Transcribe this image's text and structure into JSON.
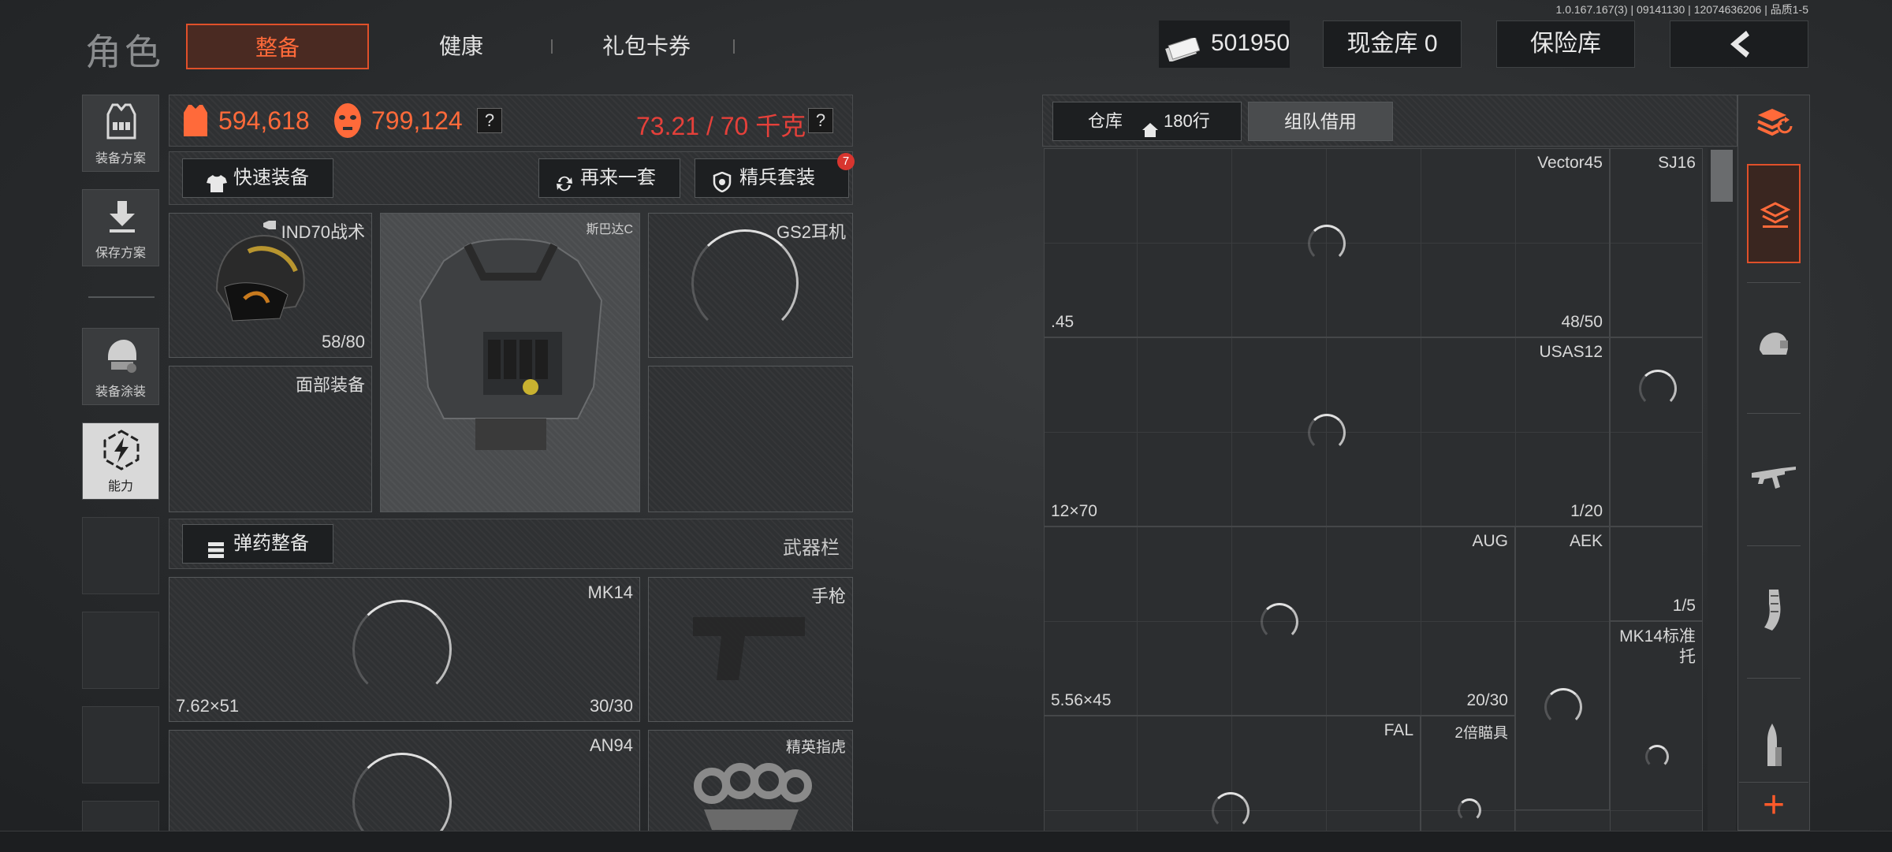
{
  "build_info": "1.0.167.167(3) | 09141130 | 12074636206 | 品质1-5",
  "header": {
    "title": "角色",
    "tabs": [
      {
        "label": "整备",
        "active": true
      },
      {
        "label": "健康",
        "active": false
      },
      {
        "label": "礼包卡券",
        "active": false
      }
    ],
    "currency": "501950",
    "cash_vault": "现金库 0",
    "safe_vault": "保险库",
    "back_icon": "chevron-left-icon"
  },
  "sidebar": {
    "items": [
      {
        "label": "装备方案",
        "icon": "vest-icon"
      },
      {
        "label": "保存方案",
        "icon": "download-icon"
      },
      {
        "label": "装备涂装",
        "icon": "helmet-paint-icon"
      },
      {
        "label": "能力",
        "icon": "ability-icon",
        "active": true
      }
    ]
  },
  "stats": {
    "armor_value": "594,618",
    "mask_value": "799,124",
    "weight": "73.21 / 70 千克",
    "help": "?"
  },
  "loadout_bar": {
    "quick_equip": "快速装备",
    "again": "再来一套",
    "elite_set": "精兵套装",
    "elite_badge": "7"
  },
  "equipment": {
    "helmet": {
      "name": "IND70战术",
      "durability": "58/80"
    },
    "armor": {
      "name": "斯巴达C"
    },
    "headset": {
      "name": "GS2耳机"
    },
    "face": {
      "name": "面部装备"
    }
  },
  "weapon_bar": {
    "ammo_button": "弹药整备",
    "title": "武器栏"
  },
  "weapons": {
    "primary": {
      "name": "MK14",
      "caliber": "7.62×51",
      "ammo": "30/30"
    },
    "pistol": {
      "name": "手枪"
    },
    "secondary": {
      "name": "AN94"
    },
    "melee": {
      "name": "精英指虎"
    }
  },
  "storage": {
    "tab_storage": "仓库",
    "tab_storage_rows": "180行",
    "tab_team": "组队借用",
    "items": [
      {
        "name": "Vector45",
        "caliber": ".45",
        "count": "48/50"
      },
      {
        "name": "SJ16"
      },
      {
        "name": "USAS12",
        "caliber": "12×70",
        "count": "1/20"
      },
      {
        "name": "AUG",
        "caliber": "5.56×45",
        "count": "20/30"
      },
      {
        "name": "AEK",
        "count": "1/5"
      },
      {
        "name": "MK14标准托"
      },
      {
        "name": "FAL"
      },
      {
        "name": "2倍瞄具"
      }
    ]
  },
  "right_toolbar": {
    "items": [
      "layers-refresh-icon",
      "stash-icon",
      "helmet-icon",
      "rifle-icon",
      "magazine-icon",
      "bullet-icon"
    ],
    "add": "+"
  },
  "colors": {
    "accent": "#ff6a3a",
    "warning": "#e5403a",
    "background": "#2a2c2e"
  }
}
